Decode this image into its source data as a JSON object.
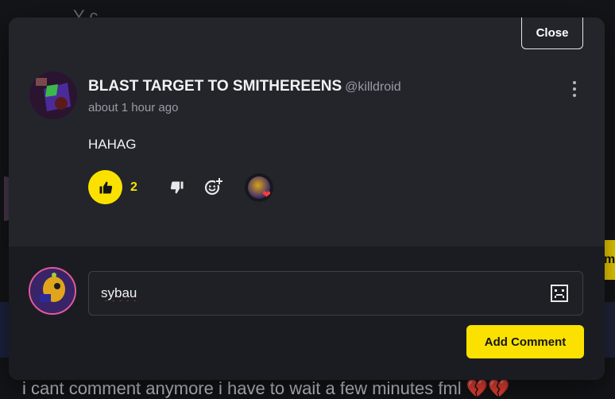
{
  "background": {
    "top_text": "Y c",
    "right_text": "m",
    "bottom_text": "i cant comment anymore i have to wait a few minutes fml",
    "bottom_hearts": "💔💔"
  },
  "modal": {
    "close_label": "Close",
    "post": {
      "author_name": "BLAST TARGET TO SMITHEREENS",
      "author_handle": "@killdroid",
      "timestamp": "about 1 hour ago",
      "body": "HAHAG",
      "like_count": "2",
      "reaction_icon": "heart-icon"
    },
    "compose": {
      "input_value": "sybau",
      "add_label": "Add Comment"
    }
  },
  "colors": {
    "accent": "#fbe100",
    "modal_bg": "#23252b",
    "compose_bg": "#1b1c21",
    "heart": "#ff3b3b"
  }
}
